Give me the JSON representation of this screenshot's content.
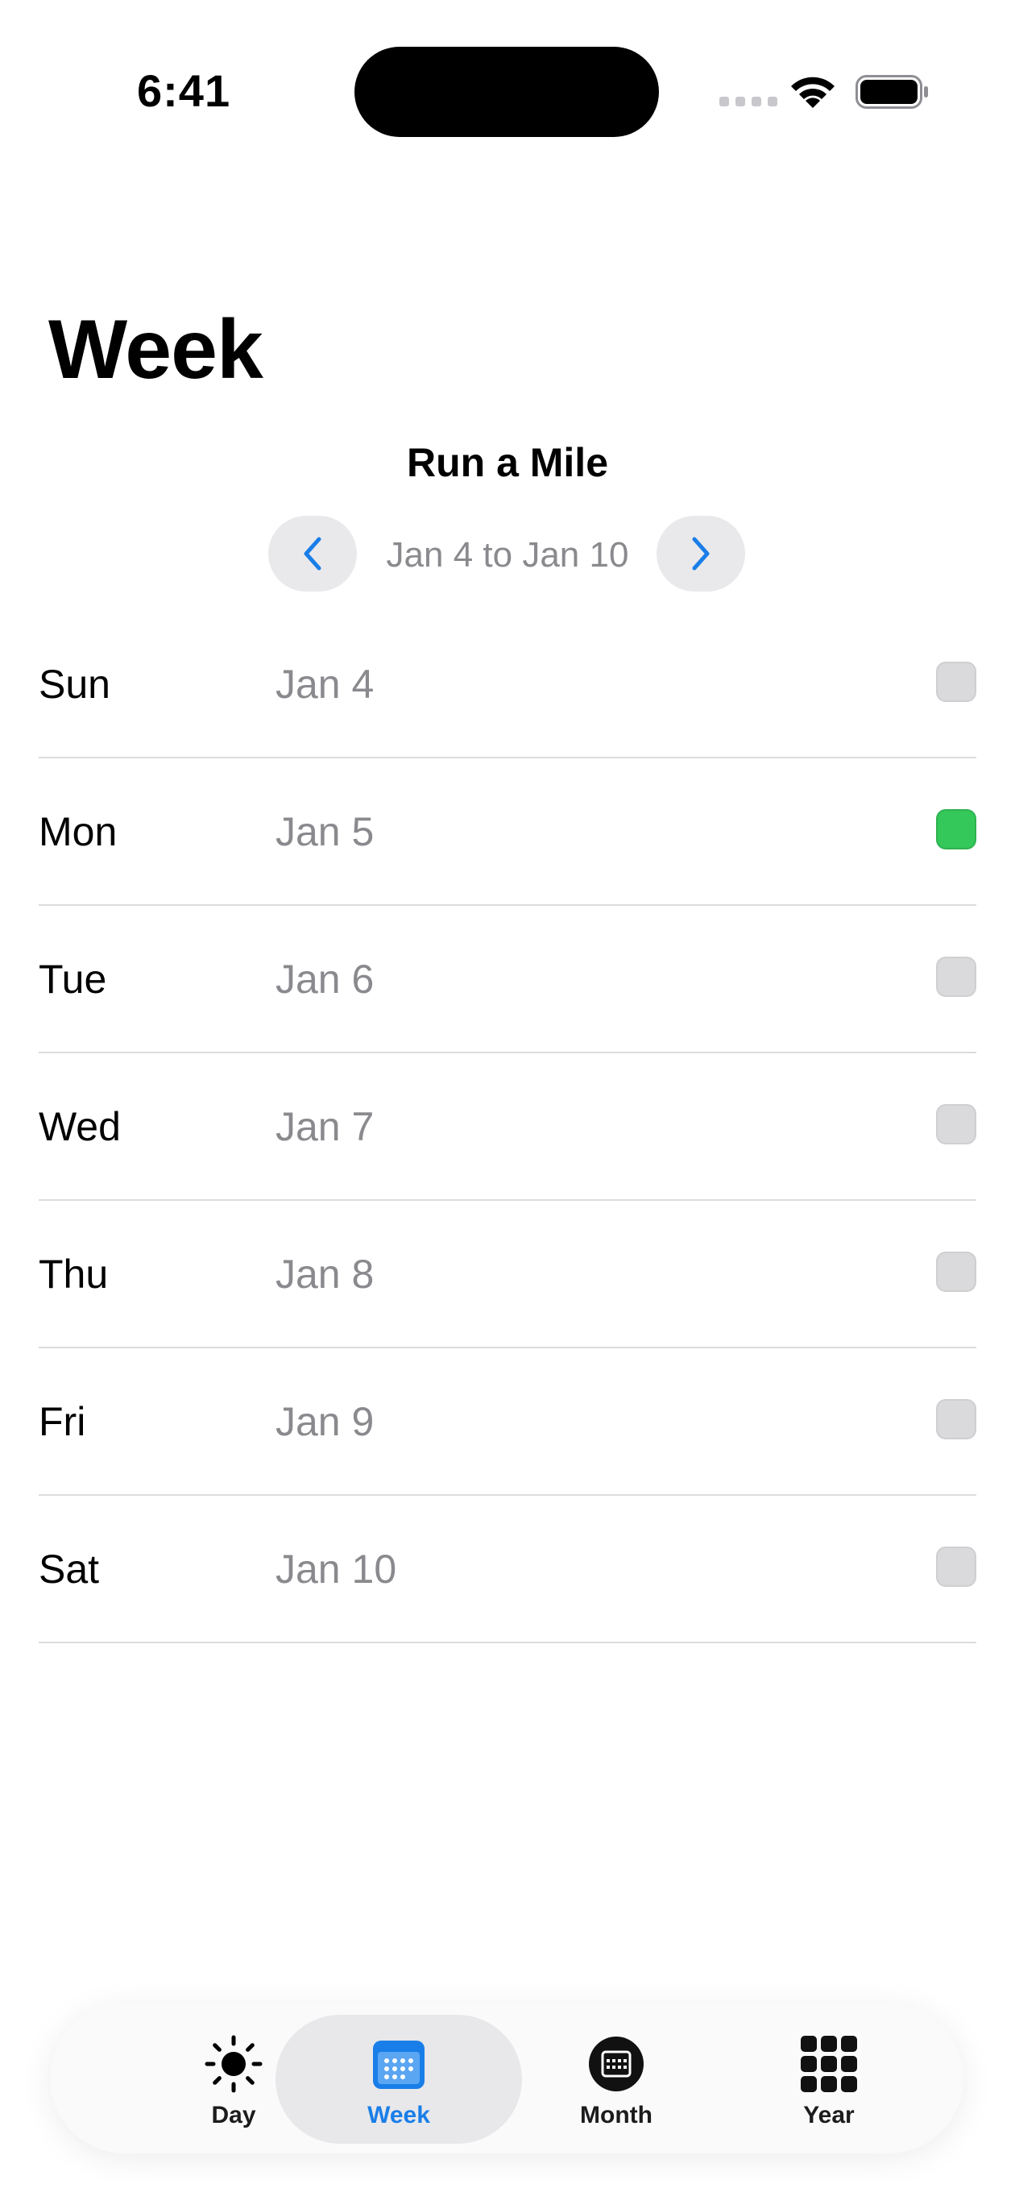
{
  "status_bar": {
    "time": "6:41"
  },
  "header": {
    "title": "Week",
    "habit_name": "Run a Mile"
  },
  "week_nav": {
    "range_label": "Jan 4 to Jan 10"
  },
  "days": [
    {
      "day": "Sun",
      "date": "Jan 4",
      "completed": false
    },
    {
      "day": "Mon",
      "date": "Jan 5",
      "completed": true
    },
    {
      "day": "Tue",
      "date": "Jan 6",
      "completed": false
    },
    {
      "day": "Wed",
      "date": "Jan 7",
      "completed": false
    },
    {
      "day": "Thu",
      "date": "Jan 8",
      "completed": false
    },
    {
      "day": "Fri",
      "date": "Jan 9",
      "completed": false
    },
    {
      "day": "Sat",
      "date": "Jan 10",
      "completed": false
    }
  ],
  "tab_bar": {
    "tabs": [
      {
        "label": "Day",
        "icon": "sun-icon"
      },
      {
        "label": "Week",
        "icon": "calendar-week-icon",
        "active": true
      },
      {
        "label": "Month",
        "icon": "calendar-circle-icon"
      },
      {
        "label": "Year",
        "icon": "grid-icon"
      }
    ]
  },
  "colors": {
    "accent": "#1a7ee8",
    "completed": "#34c759",
    "incomplete": "#dadadc"
  }
}
